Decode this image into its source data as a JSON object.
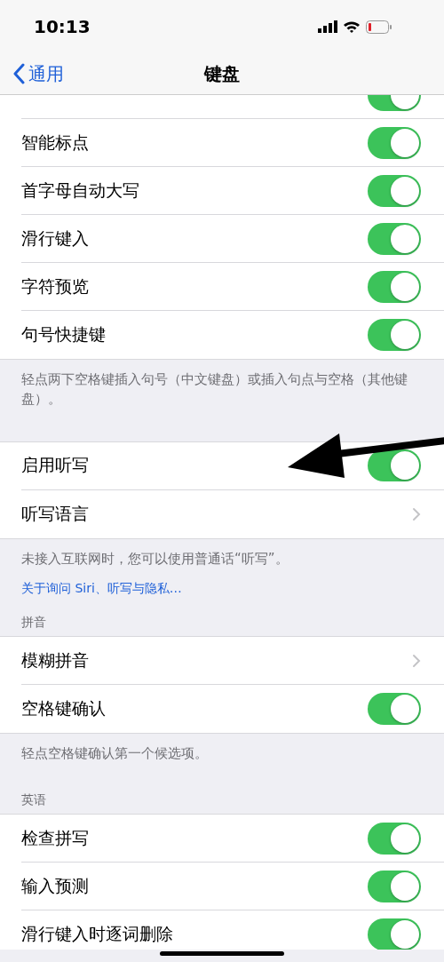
{
  "status_bar": {
    "time": "10:13"
  },
  "nav": {
    "back": "通用",
    "title": "键盘"
  },
  "sections": [
    {
      "rows": [
        {
          "kind": "toggle",
          "on": true
        },
        {
          "label": "智能标点",
          "kind": "toggle",
          "on": true
        },
        {
          "label": "首字母自动大写",
          "kind": "toggle",
          "on": true
        },
        {
          "label": "滑行键入",
          "kind": "toggle",
          "on": true
        },
        {
          "label": "字符预览",
          "kind": "toggle",
          "on": true
        },
        {
          "label": "句号快捷键",
          "kind": "toggle",
          "on": true
        }
      ],
      "footer": "轻点两下空格键插入句号（中文键盘）或插入句点与空格（其他键盘）。"
    },
    {
      "rows": [
        {
          "label": "启用听写",
          "kind": "toggle",
          "on": true
        },
        {
          "label": "听写语言",
          "kind": "disclosure"
        }
      ],
      "footer": "未接入互联网时，您可以使用普通话“听写”。",
      "footer_link": "关于询问 Siri、听写与隐私…"
    },
    {
      "header": "拼音",
      "rows": [
        {
          "label": "模糊拼音",
          "kind": "disclosure"
        },
        {
          "label": "空格键确认",
          "kind": "toggle",
          "on": true
        }
      ],
      "footer": "轻点空格键确认第一个候选项。"
    },
    {
      "header": "英语",
      "rows": [
        {
          "label": "检查拼写",
          "kind": "toggle",
          "on": true
        },
        {
          "label": "输入预测",
          "kind": "toggle",
          "on": true
        },
        {
          "label": "滑行键入时逐词删除",
          "kind": "toggle",
          "on": true
        }
      ]
    }
  ]
}
